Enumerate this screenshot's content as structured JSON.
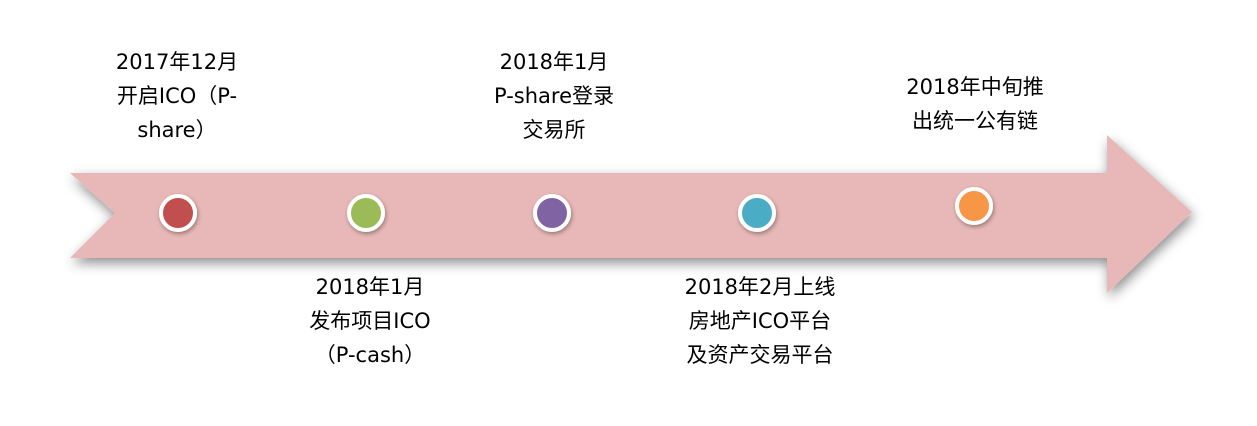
{
  "arrow_color": "#e7b8b7",
  "events": [
    {
      "lines": [
        "2017年12月",
        "开启ICO（P-",
        "share）"
      ],
      "color": "#c0504d",
      "side": "top"
    },
    {
      "lines": [
        "2018年1月",
        "发布项目ICO",
        "（P-cash）"
      ],
      "color": "#9bbb59",
      "side": "bottom"
    },
    {
      "lines": [
        "2018年1月",
        "P-share登录",
        "交易所"
      ],
      "color": "#8064a2",
      "side": "top"
    },
    {
      "lines": [
        "2018年2月上线",
        "房地产ICO平台",
        "及资产交易平台"
      ],
      "color": "#4bacc6",
      "side": "bottom"
    },
    {
      "lines": [
        "2018年中旬推",
        "出统一公有链"
      ],
      "color": "#f79646",
      "side": "top"
    }
  ]
}
